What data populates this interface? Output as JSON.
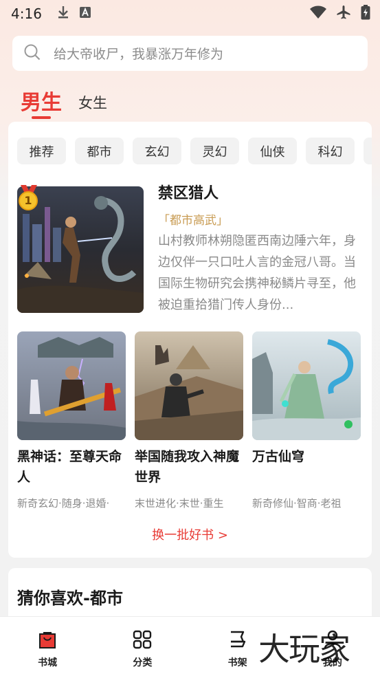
{
  "status_bar": {
    "time": "4:16",
    "left_icons": [
      "download-icon",
      "text-a-icon"
    ],
    "right_icons": [
      "wifi-icon",
      "airplane-icon",
      "battery-charging-icon"
    ]
  },
  "search": {
    "placeholder": "给大帝收尸，我暴涨万年修为"
  },
  "gender_tabs": {
    "male": "男生",
    "female": "女生",
    "active": "male"
  },
  "categories": [
    "推荐",
    "都市",
    "玄幻",
    "灵幻",
    "仙侠",
    "科幻"
  ],
  "featured": {
    "rank": "1",
    "title": "禁区猎人",
    "tag": "「都市高武」",
    "description": "山村教师林朔隐匿西南边陲六年，身边仅伴一只口吐人言的金冠八哥。当国际生物研究会携神秘鳞片寻至，他被迫重拾猎门传人身份..."
  },
  "books": [
    {
      "title": "黑神话：至尊天命人",
      "tags": "新奇玄幻·随身·退婚·"
    },
    {
      "title": "举国随我攻入神魔世界",
      "tags": "末世进化·末世·重生"
    },
    {
      "title": "万古仙穹",
      "tags": "新奇修仙·智商·老祖"
    }
  ],
  "refresh_label": "换一批好书 >",
  "guess": {
    "title": "猜你喜欢-都市"
  },
  "bottom_nav": [
    {
      "label": "书城",
      "icon": "bag-icon",
      "active": true
    },
    {
      "label": "分类",
      "icon": "grid-icon",
      "active": false
    },
    {
      "label": "书架",
      "icon": "shelf-icon",
      "active": false
    },
    {
      "label": "我的",
      "icon": "user-icon",
      "active": false
    }
  ],
  "watermark": "大玩家",
  "colors": {
    "accent": "#e83b35",
    "tag_gold": "#c89b52"
  }
}
